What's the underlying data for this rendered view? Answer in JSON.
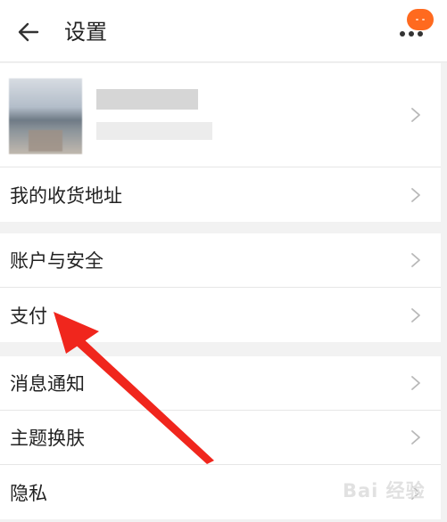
{
  "header": {
    "title": "设置"
  },
  "groups": {
    "profile": {
      "address_label": "我的收货地址"
    },
    "security": {
      "account_label": "账户与安全",
      "payment_label": "支付"
    },
    "prefs": {
      "notify_label": "消息通知",
      "theme_label": "主题换肤",
      "privacy_label": "隐私"
    }
  },
  "icons": {
    "back": "arrow-left-icon",
    "more": "more-dots-icon",
    "chevron": "chevron-right-icon"
  },
  "colors": {
    "accent": "#ff6a1f",
    "annotation": "#f0261d"
  },
  "watermark": "Bai 经验"
}
